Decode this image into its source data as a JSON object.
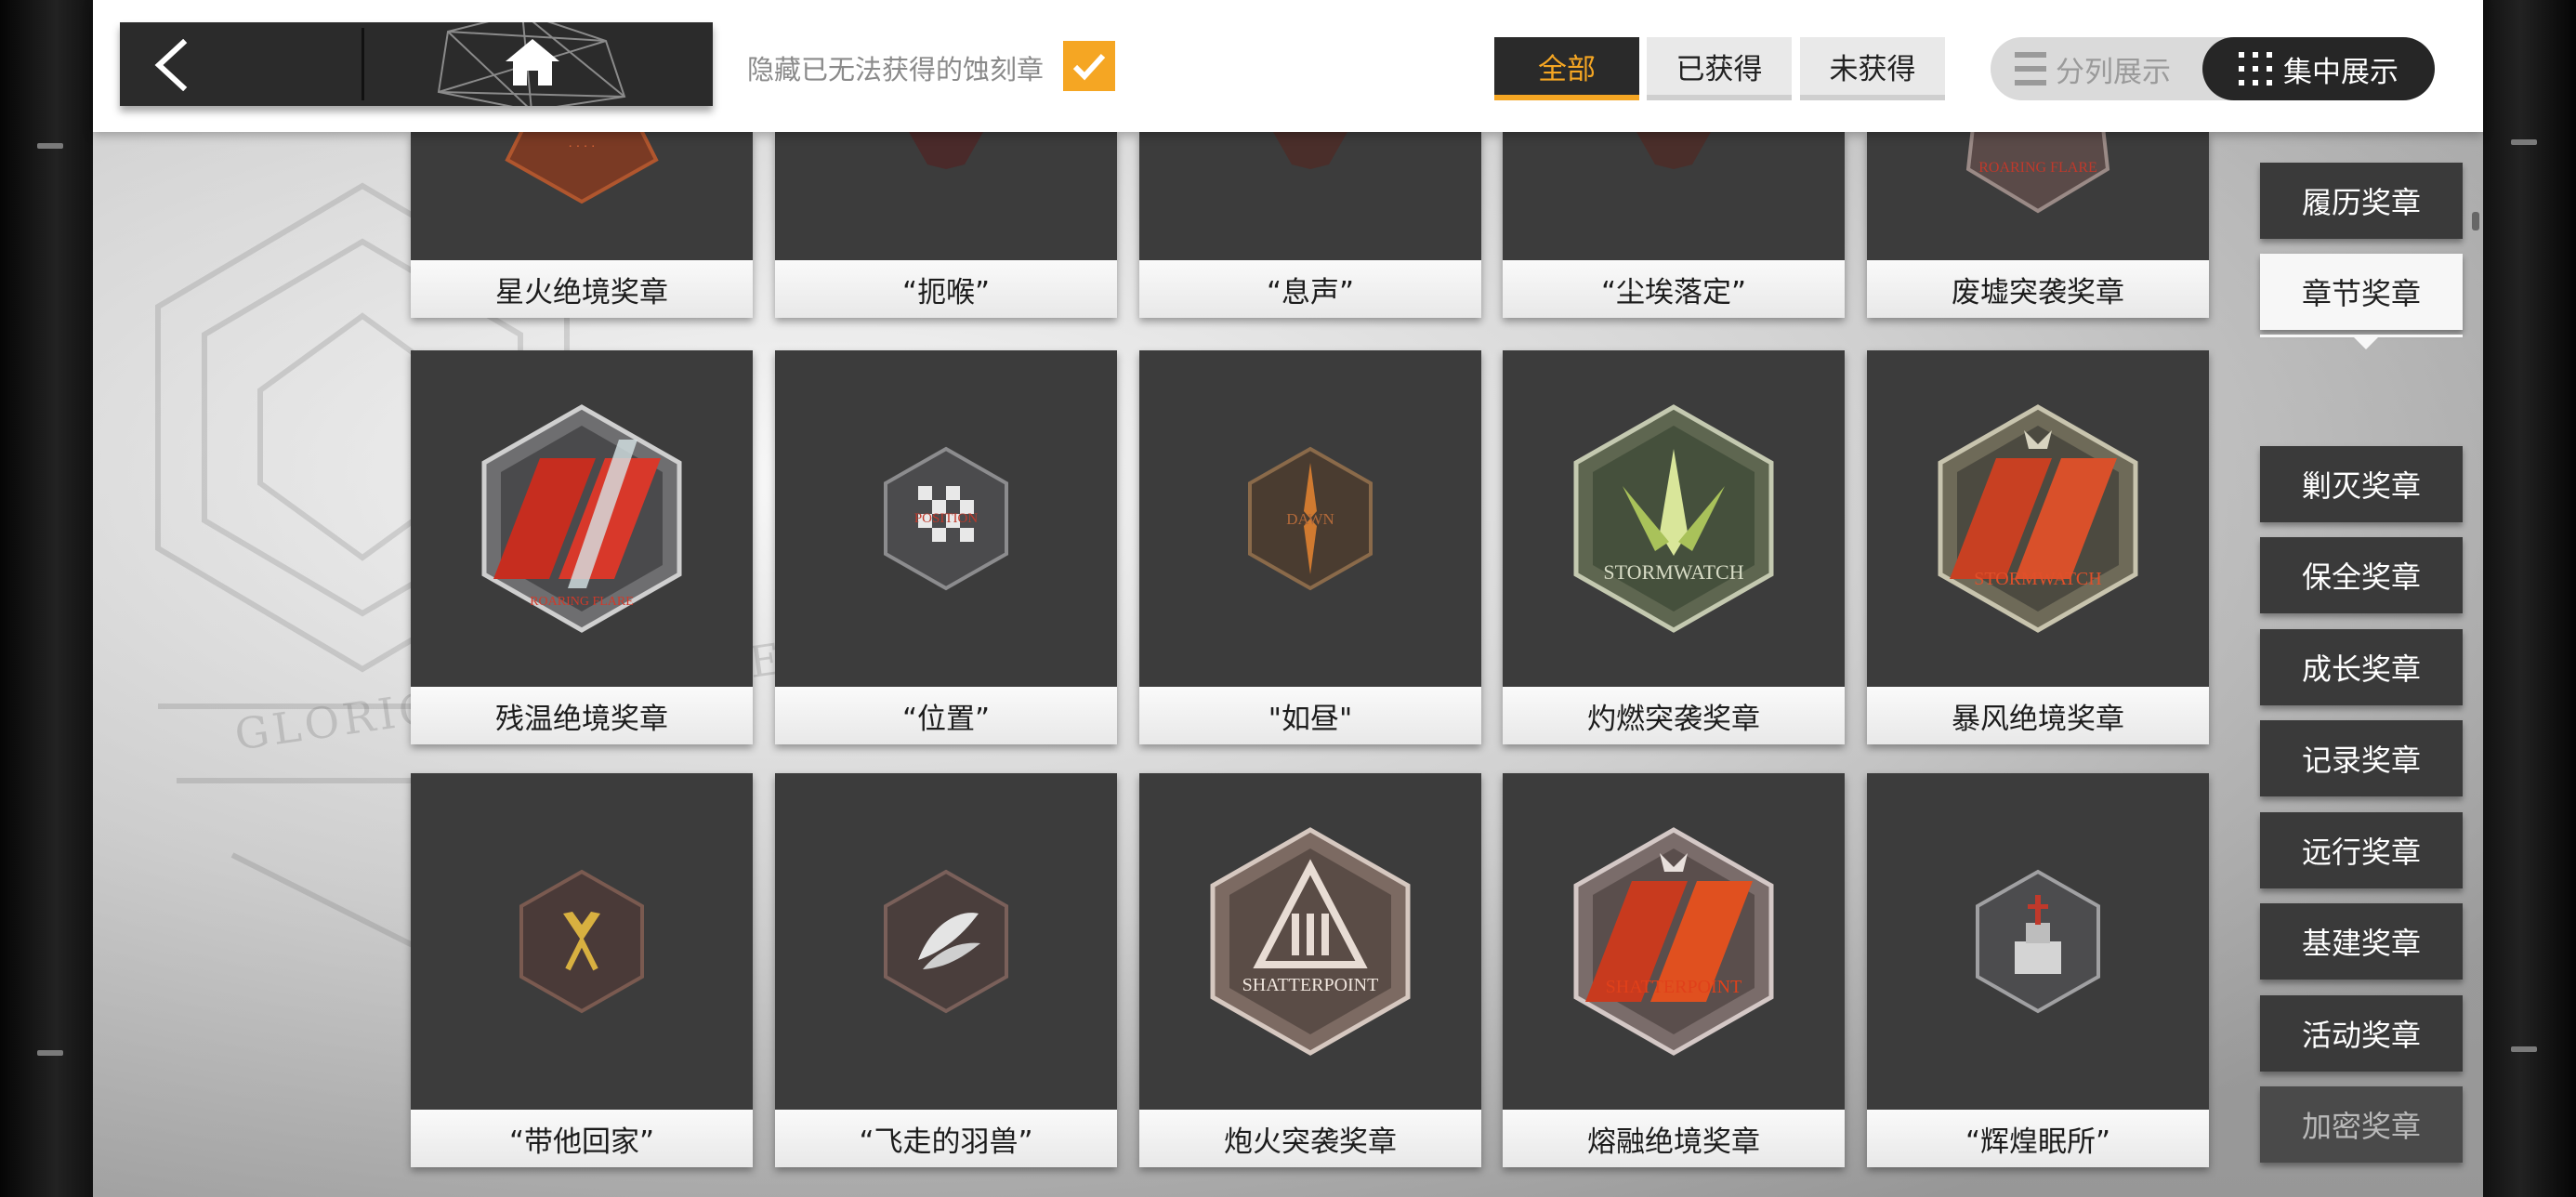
{
  "header": {
    "hide_unobtainable_label": "隐藏已无法获得的蚀刻章",
    "hide_unobtainable_checked": true,
    "filters": [
      {
        "label": "全部",
        "active": true
      },
      {
        "label": "已获得",
        "active": false
      },
      {
        "label": "未获得",
        "active": false
      }
    ],
    "view_modes": [
      {
        "label": "分列展示",
        "active": false
      },
      {
        "label": "集中展示",
        "active": true
      }
    ]
  },
  "medals": [
    {
      "name": "星火绝境奖章"
    },
    {
      "name": "“扼喉”"
    },
    {
      "name": "“息声”"
    },
    {
      "name": "“尘埃落定”"
    },
    {
      "name": "废墟突袭奖章"
    },
    {
      "name": "残温绝境奖章",
      "emblem_text": "ROARING FLARE"
    },
    {
      "name": "“位置”",
      "emblem_text": "POSITION"
    },
    {
      "name": "\"如昼\"",
      "emblem_text": "DAWN"
    },
    {
      "name": "灼燃突袭奖章",
      "emblem_text": "STORMWATCH"
    },
    {
      "name": "暴风绝境奖章",
      "emblem_text": "STORMWATCH"
    },
    {
      "name": "“带他回家”"
    },
    {
      "name": "“飞走的羽兽”"
    },
    {
      "name": "炮火突袭奖章",
      "emblem_text": "SHATTERPOINT"
    },
    {
      "name": "熔融绝境奖章",
      "emblem_text": "SHATTERPOINT"
    },
    {
      "name": "“辉煌眠所”"
    }
  ],
  "categories": [
    {
      "label": "履历奖章",
      "state": "normal"
    },
    {
      "label": "章节奖章",
      "state": "active"
    },
    {
      "label": "剿灭奖章",
      "state": "normal"
    },
    {
      "label": "保全奖章",
      "state": "normal"
    },
    {
      "label": "成长奖章",
      "state": "normal"
    },
    {
      "label": "记录奖章",
      "state": "normal"
    },
    {
      "label": "远行奖章",
      "state": "normal"
    },
    {
      "label": "基建奖章",
      "state": "normal"
    },
    {
      "label": "活动奖章",
      "state": "normal"
    },
    {
      "label": "加密奖章",
      "state": "dim"
    }
  ],
  "colors": {
    "accent": "#f5a623",
    "card_bg": "#3c3c3c",
    "label_bg": "#f2f2f2",
    "category_bg": "#3a3a3a"
  },
  "icons": {
    "back": "chevron-left-icon",
    "home": "home-icon",
    "check": "checkmark-icon",
    "split_view": "list-lines-icon",
    "focus_view": "dot-grid-icon"
  }
}
